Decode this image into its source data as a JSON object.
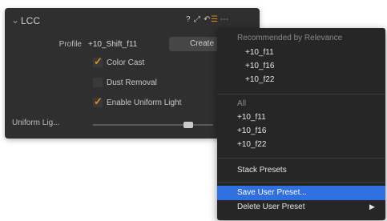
{
  "panel": {
    "title": "LCC",
    "profile_label": "Profile",
    "profile_value": "+10_Shift_f11",
    "create_label": "Create",
    "checks": [
      {
        "label": "Color Cast",
        "checked": true
      },
      {
        "label": "Dust Removal",
        "checked": false
      },
      {
        "label": "Enable Uniform Light",
        "checked": true
      }
    ],
    "slider_label": "Uniform Lig...",
    "slider_value": 0.82,
    "accent_color": "#e08a1e"
  },
  "menu": {
    "recommended_header": "Recommended by Relevance",
    "recommended_items": [
      "+10_f11",
      "+10_f16",
      "+10_f22"
    ],
    "all_header": "All",
    "all_items": [
      "+10_f11",
      "+10_f16",
      "+10_f22"
    ],
    "stack_presets": "Stack Presets",
    "save_user_preset": "Save User Preset...",
    "delete_user_preset": "Delete User Preset",
    "highlight_color": "#2f6fe0"
  }
}
